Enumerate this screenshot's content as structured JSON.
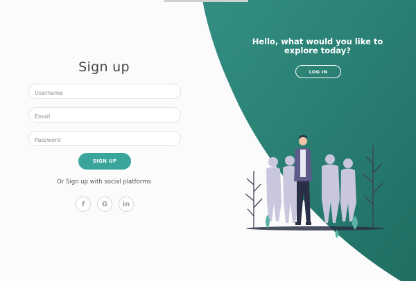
{
  "signup": {
    "title": "Sign up",
    "username_placeholder": "Username",
    "email_placeholder": "Email",
    "password_placeholder": "Password",
    "button_label": "SIGN UP",
    "social_text": "Or Sign up with social platforms",
    "social": [
      {
        "icon": "facebook-icon",
        "glyph": "f"
      },
      {
        "icon": "google-icon",
        "glyph": "G"
      },
      {
        "icon": "linkedin-icon",
        "glyph": "in"
      }
    ]
  },
  "panel": {
    "heading": "Hello, what would you like to explore today?",
    "login_label": "LOG IN"
  },
  "colors": {
    "accent": "#3aa69b",
    "panel_green": "#2f8a7d",
    "panel_dark": "#1d6a5e"
  }
}
